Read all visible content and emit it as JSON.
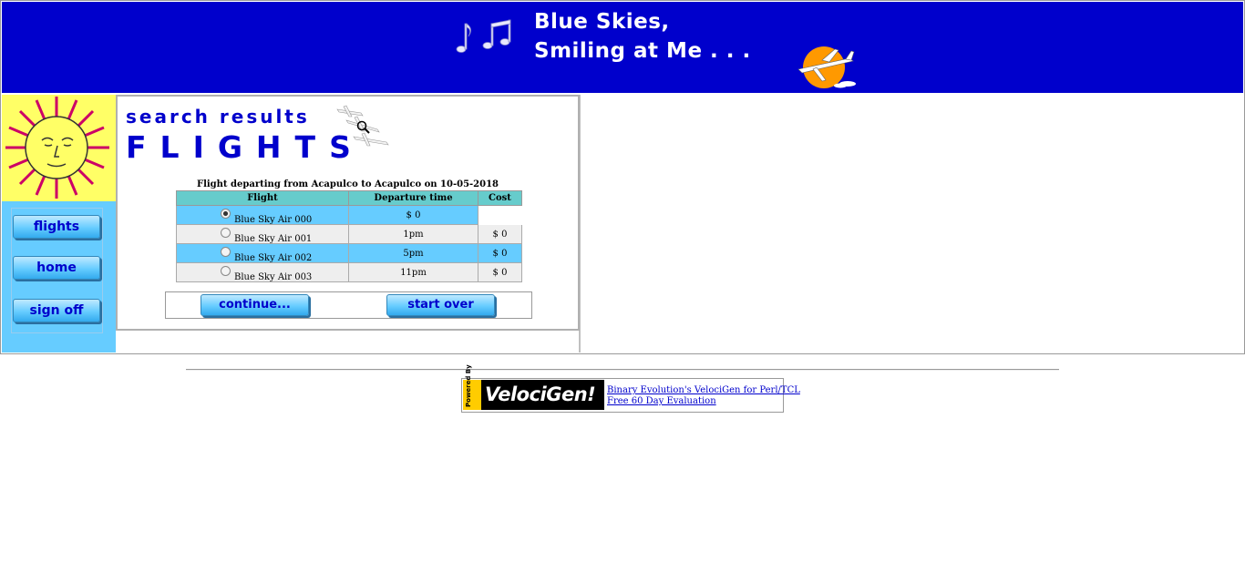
{
  "banner": {
    "line1": "Blue Skies,",
    "line2": "Smiling at Me . . ."
  },
  "nav": {
    "flights": "flights",
    "home": "home",
    "sign_off": "sign off"
  },
  "content": {
    "title_small": "search results",
    "title_large": "FLIGHTS",
    "caption": "Flight departing from Acapulco to Acapulco on 10-05-2018",
    "columns": [
      "Flight",
      "Departure time",
      "Cost"
    ],
    "rows": [
      {
        "flight": "Blue Sky Air 000",
        "time": "",
        "cost": "$ 0",
        "selected": true
      },
      {
        "flight": "Blue Sky Air 001",
        "time": "1pm",
        "cost": "$ 0",
        "selected": false
      },
      {
        "flight": "Blue Sky Air 002",
        "time": "5pm",
        "cost": "$ 0",
        "selected": false
      },
      {
        "flight": "Blue Sky Air 003",
        "time": "11pm",
        "cost": "$ 0",
        "selected": false
      }
    ],
    "continue_label": "continue...",
    "start_over_label": "start over"
  },
  "footer": {
    "logo_tag": "Powered By",
    "logo_name": "VelociGen!",
    "link1": "Binary Evolution's VelociGen for Perl/TCL",
    "link2": "Free 60 Day Evaluation"
  },
  "colors": {
    "banner": "#0000cc",
    "sidebar": "#66ccff",
    "title": "#0000cc",
    "table_header": "#66cccc"
  }
}
